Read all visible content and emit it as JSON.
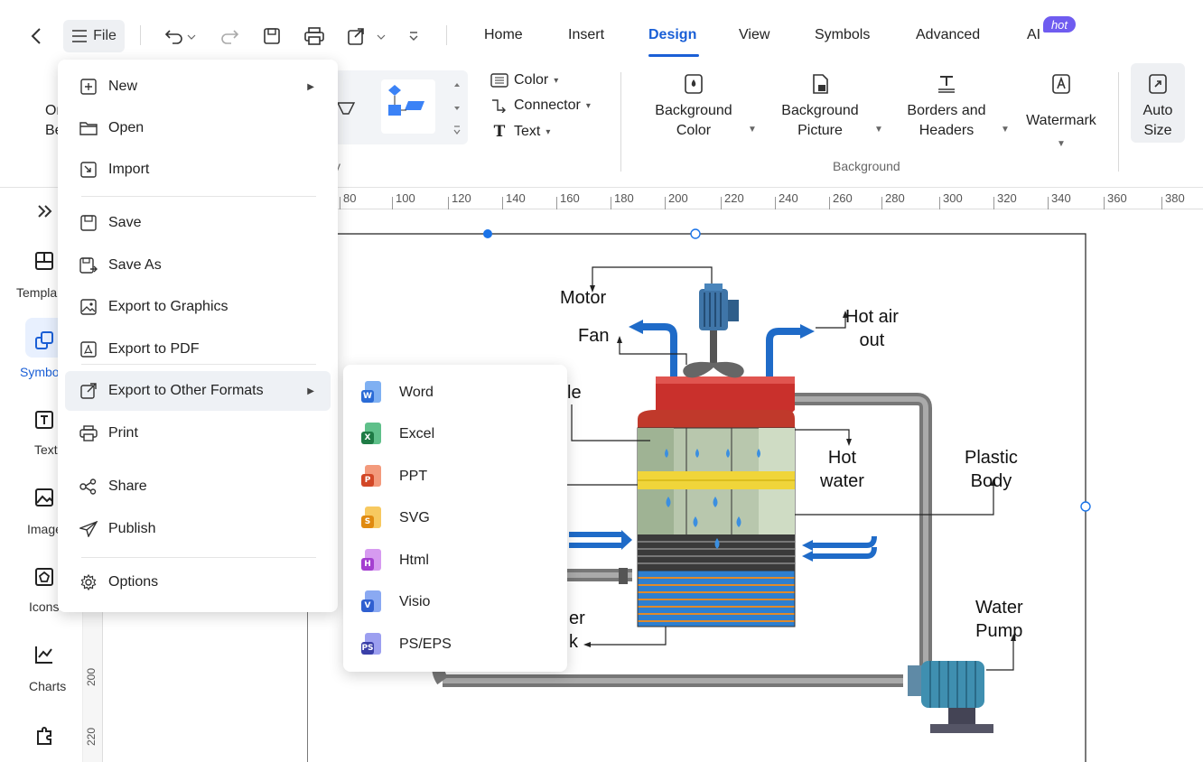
{
  "toolbar": {
    "file_label": "File",
    "tabs": [
      "Home",
      "Insert",
      "Design",
      "View",
      "Symbols",
      "Advanced",
      "AI"
    ],
    "active_tab": "Design",
    "hot_badge": "hot"
  },
  "ribbon": {
    "one_click_partial": [
      "One",
      "Be"
    ],
    "color_label": "Color",
    "connector_label": "Connector",
    "text_label": "Text",
    "bg_color": [
      "Background",
      "Color"
    ],
    "bg_picture": [
      "Background",
      "Picture"
    ],
    "borders": [
      "Borders and",
      "Headers"
    ],
    "watermark": "Watermark",
    "auto_size": [
      "Auto",
      "Size"
    ],
    "group_background": "Background",
    "group_partial": "y"
  },
  "sidebar": {
    "items": [
      "Templa",
      "Symbo",
      "Text",
      "Image",
      "Icons",
      "Charts"
    ]
  },
  "ruler": {
    "h_ticks": [
      "80",
      "100",
      "120",
      "140",
      "160",
      "180",
      "200",
      "220",
      "240",
      "260",
      "280",
      "300",
      "320",
      "340",
      "360",
      "380"
    ],
    "v_ticks": [
      "200",
      "220"
    ]
  },
  "file_menu": {
    "items": [
      {
        "label": "New",
        "icon": "plus-square-icon",
        "submenu": true
      },
      {
        "label": "Open",
        "icon": "folder-icon"
      },
      {
        "label": "Import",
        "icon": "import-icon"
      },
      {
        "label": "Save",
        "icon": "save-icon"
      },
      {
        "label": "Save As",
        "icon": "save-as-icon"
      },
      {
        "label": "Export to Graphics",
        "icon": "image-export-icon"
      },
      {
        "label": "Export to PDF",
        "icon": "pdf-export-icon"
      },
      {
        "label": "Export to Other Formats",
        "icon": "export-icon",
        "submenu": true
      },
      {
        "label": "Print",
        "icon": "printer-icon"
      },
      {
        "label": "Share",
        "icon": "share-icon"
      },
      {
        "label": "Publish",
        "icon": "send-icon"
      },
      {
        "label": "Options",
        "icon": "gear-icon"
      }
    ]
  },
  "export_submenu": {
    "items": [
      {
        "label": "Word",
        "badge": "W",
        "color": "#2b6bd6",
        "page": "#7fb0f2"
      },
      {
        "label": "Excel",
        "badge": "X",
        "color": "#1e7b45",
        "page": "#5fc08a"
      },
      {
        "label": "PPT",
        "badge": "P",
        "color": "#d24726",
        "page": "#f39a7c"
      },
      {
        "label": "SVG",
        "badge": "S",
        "color": "#e08a10",
        "page": "#f7c960"
      },
      {
        "label": "Html",
        "badge": "H",
        "color": "#a43fd0",
        "page": "#d69af0"
      },
      {
        "label": "Visio",
        "badge": "V",
        "color": "#2f5fd0",
        "page": "#8aa9f2"
      },
      {
        "label": "PS/EPS",
        "badge": "PS",
        "color": "#3a3fa8",
        "page": "#9c9ff0"
      }
    ]
  },
  "diagram": {
    "labels": {
      "motor": "Motor",
      "fan": "Fan",
      "hot_air": [
        "Hot air",
        "out"
      ],
      "nozzle_partial": "le",
      "hot_water": [
        "Hot",
        "water"
      ],
      "plastic_body": [
        "Plastic",
        "Body"
      ],
      "water_pump": [
        "Water",
        "Pump"
      ],
      "tank_partial": [
        "er",
        "k"
      ]
    }
  },
  "colors": {
    "accent": "#1a5fd6",
    "selection": "#1a73e8"
  }
}
